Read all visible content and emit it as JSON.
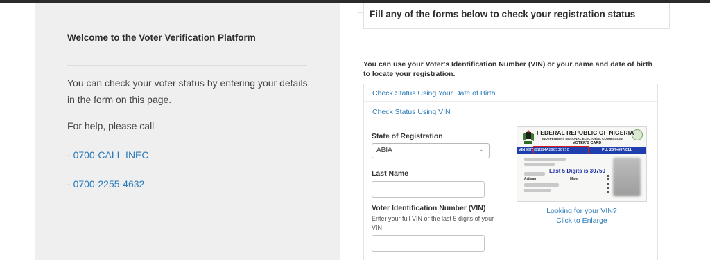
{
  "left": {
    "title": "Welcome to the Voter Verification Platform",
    "intro": "You can check your voter status by entering your details in the form on this page.",
    "help_text": "For help, please call",
    "phones": [
      {
        "prefix": "- ",
        "number": "0700-CALL-INEC"
      },
      {
        "prefix": "- ",
        "number": "0700-2255-4632"
      }
    ]
  },
  "header": {
    "title": "Fill any of the forms below to check your registration status"
  },
  "intro_text": "You can use your Voter's Identification Number (VIN) or your name and date of birth to locate your registration.",
  "tabs": [
    {
      "label": "Check Status Using Your Date of Birth"
    },
    {
      "label": "Check Status Using VIN"
    }
  ],
  "form": {
    "state": {
      "label": "State of Registration",
      "value": "ABIA"
    },
    "last_name": {
      "label": "Last Name",
      "value": ""
    },
    "vin": {
      "label": "Voter Identification Number (VIN)",
      "hint": "Enter your full VIN or the last 5 digits of your VIN",
      "value": ""
    }
  },
  "voter_card": {
    "title": "FEDERAL REPUBLIC OF NIGERIA",
    "subtitle": "INDEPENDENT NATIONAL ELECTORAL COMMISSION",
    "card_name": "VOTER'S CARD",
    "vin_label": "VIN",
    "vin_value": "90F5B1B84A296530750",
    "pu": "PU: 28/04/07/011",
    "last5_text": "Last 5 Digits is 30750",
    "occupation": "Artisan",
    "gender": "Male",
    "colors": {
      "bar": "#1f3fae",
      "highlight": "#d91c1c"
    }
  },
  "vin_help": {
    "line1": "Looking for your VIN?",
    "line2": "Click to Enlarge"
  }
}
